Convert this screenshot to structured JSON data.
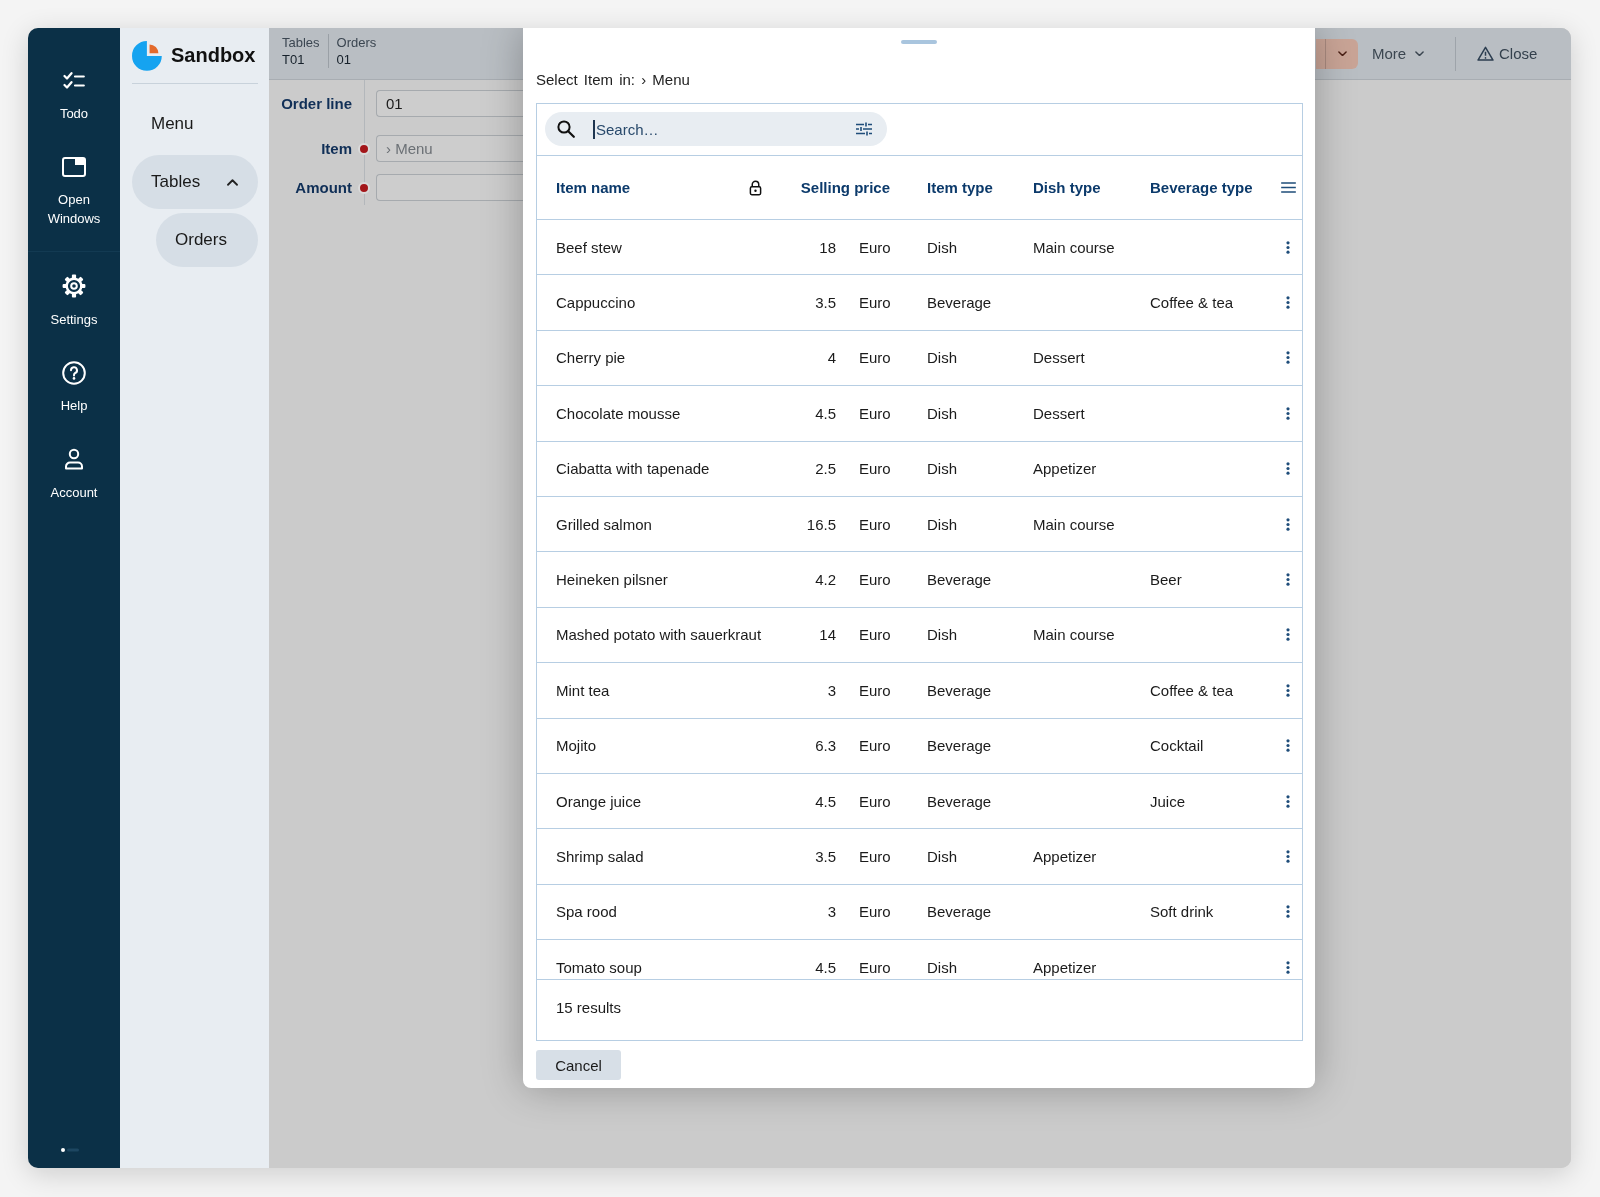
{
  "sidebar": {
    "sections": [
      {
        "items": [
          {
            "label": "Todo"
          },
          {
            "label": "Open Windows"
          }
        ]
      },
      {
        "items": [
          {
            "label": "Settings"
          },
          {
            "label": "Help"
          },
          {
            "label": "Account"
          }
        ]
      }
    ]
  },
  "nav": {
    "app_name": "Sandbox",
    "items": [
      {
        "label": "Menu",
        "selected": false
      },
      {
        "label": "Tables",
        "selected": true,
        "expanded": true,
        "children": [
          {
            "label": "Orders",
            "selected": true
          }
        ]
      }
    ]
  },
  "header": {
    "breadcrumb": [
      {
        "label": "Tables",
        "value": "T01"
      },
      {
        "label": "Orders",
        "value": "01"
      }
    ],
    "actions": [
      {
        "kind": "dropdown"
      },
      {
        "kind": "menu",
        "label": "More"
      },
      {
        "kind": "close",
        "label": "Close"
      }
    ]
  },
  "form": {
    "fields": [
      {
        "label": "Order line",
        "value": "01",
        "required": false
      },
      {
        "label": "Item",
        "placeholder": "› Menu",
        "required": true
      },
      {
        "label": "Amount",
        "required": true
      }
    ]
  },
  "dialog": {
    "title": "Select Item in: › Menu",
    "search": {
      "placeholder": "Search…",
      "focused": true
    },
    "table": {
      "columns": [
        {
          "label": "Item name",
          "locked": true
        },
        {
          "label": "Selling price",
          "locked": false
        },
        {
          "label": "Item type",
          "locked": false
        },
        {
          "label": "Dish type",
          "locked": false
        },
        {
          "label": "Beverage type",
          "locked": false
        }
      ],
      "rows": [
        {
          "name": "Beef stew",
          "price": "18",
          "currency": "Euro",
          "item_type": "Dish",
          "dish_type": "Main course"
        },
        {
          "name": "Cappuccino",
          "price": "3.5",
          "currency": "Euro",
          "item_type": "Beverage",
          "beverage_type": "Coffee & tea"
        },
        {
          "name": "Cherry pie",
          "price": "4",
          "currency": "Euro",
          "item_type": "Dish",
          "dish_type": "Dessert"
        },
        {
          "name": "Chocolate mousse",
          "price": "4.5",
          "currency": "Euro",
          "item_type": "Dish",
          "dish_type": "Dessert"
        },
        {
          "name": "Ciabatta with tapenade",
          "price": "2.5",
          "currency": "Euro",
          "item_type": "Dish",
          "dish_type": "Appetizer"
        },
        {
          "name": "Grilled salmon",
          "price": "16.5",
          "currency": "Euro",
          "item_type": "Dish",
          "dish_type": "Main course"
        },
        {
          "name": "Heineken pilsner",
          "price": "4.2",
          "currency": "Euro",
          "item_type": "Beverage",
          "beverage_type": "Beer"
        },
        {
          "name": "Mashed potato with sauerkraut",
          "price": "14",
          "currency": "Euro",
          "item_type": "Dish",
          "dish_type": "Main course"
        },
        {
          "name": "Mint tea",
          "price": "3",
          "currency": "Euro",
          "item_type": "Beverage",
          "beverage_type": "Coffee & tea"
        },
        {
          "name": "Mojito",
          "price": "6.3",
          "currency": "Euro",
          "item_type": "Beverage",
          "beverage_type": "Cocktail"
        },
        {
          "name": "Orange juice",
          "price": "4.5",
          "currency": "Euro",
          "item_type": "Beverage",
          "beverage_type": "Juice"
        },
        {
          "name": "Shrimp salad",
          "price": "3.5",
          "currency": "Euro",
          "item_type": "Dish",
          "dish_type": "Appetizer"
        },
        {
          "name": "Spa rood",
          "price": "3",
          "currency": "Euro",
          "item_type": "Beverage",
          "beverage_type": "Soft drink"
        },
        {
          "name": "Tomato soup",
          "price": "4.5",
          "currency": "Euro",
          "item_type": "Dish",
          "dish_type": "Appetizer"
        }
      ]
    },
    "result_count": "15 results",
    "buttons": [
      {
        "label": "Cancel"
      }
    ]
  }
}
